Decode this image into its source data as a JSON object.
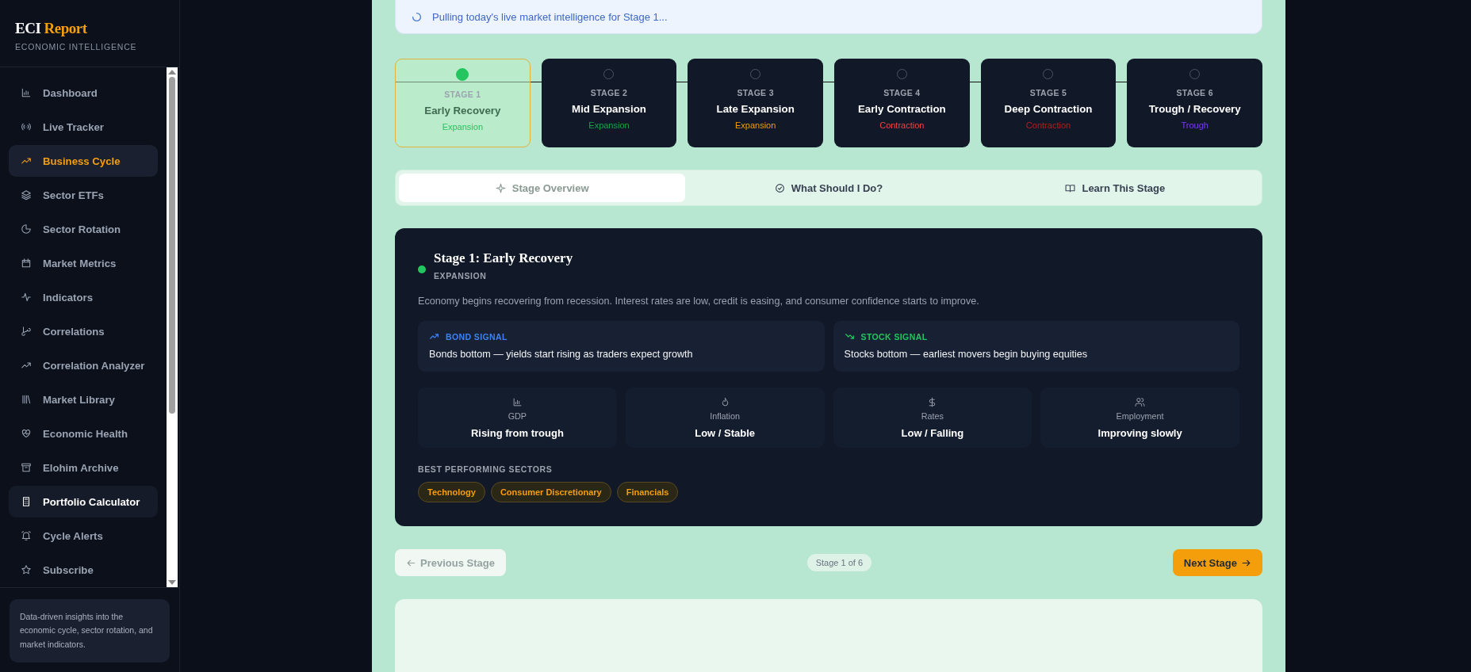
{
  "brand": {
    "name_a": "ECI",
    "name_b": "Report",
    "subtitle": "ECONOMIC INTELLIGENCE"
  },
  "sidebar": {
    "items": [
      {
        "label": "Dashboard",
        "selected": false,
        "hovered": false
      },
      {
        "label": "Live Tracker",
        "selected": false,
        "hovered": false
      },
      {
        "label": "Business Cycle",
        "selected": true,
        "hovered": false
      },
      {
        "label": "Sector ETFs",
        "selected": false,
        "hovered": false
      },
      {
        "label": "Sector Rotation",
        "selected": false,
        "hovered": false
      },
      {
        "label": "Market Metrics",
        "selected": false,
        "hovered": false
      },
      {
        "label": "Indicators",
        "selected": false,
        "hovered": false
      },
      {
        "label": "Correlations",
        "selected": false,
        "hovered": false
      },
      {
        "label": "Correlation Analyzer",
        "selected": false,
        "hovered": false
      },
      {
        "label": "Market Library",
        "selected": false,
        "hovered": false
      },
      {
        "label": "Economic Health",
        "selected": false,
        "hovered": false
      },
      {
        "label": "Elohim Archive",
        "selected": false,
        "hovered": false
      },
      {
        "label": "Portfolio Calculator",
        "selected": false,
        "hovered": true
      },
      {
        "label": "Cycle Alerts",
        "selected": false,
        "hovered": false
      },
      {
        "label": "Subscribe",
        "selected": false,
        "hovered": false
      }
    ],
    "footer": "Data-driven insights into the economic cycle, sector rotation, and market indicators."
  },
  "banner": {
    "text": "Pulling today's live market intelligence for Stage 1..."
  },
  "stages": [
    {
      "number": "STAGE 1",
      "name": "Early Recovery",
      "phase": "Expansion",
      "color": "#22c55e",
      "selected": true
    },
    {
      "number": "STAGE 2",
      "name": "Mid Expansion",
      "phase": "Expansion",
      "color": "#16a34a",
      "selected": false
    },
    {
      "number": "STAGE 3",
      "name": "Late Expansion",
      "phase": "Expansion",
      "color": "#f59e0b",
      "selected": false
    },
    {
      "number": "STAGE 4",
      "name": "Early Contraction",
      "phase": "Contraction",
      "color": "#ef4444",
      "selected": false
    },
    {
      "number": "STAGE 5",
      "name": "Deep Contraction",
      "phase": "Contraction",
      "color": "#b91c1c",
      "selected": false
    },
    {
      "number": "STAGE 6",
      "name": "Trough / Recovery",
      "phase": "Trough",
      "color": "#7c3aed",
      "selected": false
    }
  ],
  "tabs": [
    {
      "label": "Stage Overview",
      "selected": true
    },
    {
      "label": "What Should I Do?",
      "selected": false
    },
    {
      "label": "Learn This Stage",
      "selected": false
    }
  ],
  "detail": {
    "title": "Stage 1: Early Recovery",
    "phase": "EXPANSION",
    "color": "#22c55e",
    "description": "Economy begins recovering from recession. Interest rates are low, credit is easing, and consumer confidence starts to improve.",
    "signals": [
      {
        "kind": "bond",
        "label": "BOND SIGNAL",
        "text": "Bonds bottom — yields start rising as traders expect growth",
        "color": "#3b82f6"
      },
      {
        "kind": "stock",
        "label": "STOCK SIGNAL",
        "text": "Stocks bottom — earliest movers begin buying equities",
        "color": "#22c55e"
      }
    ],
    "metrics": [
      {
        "label": "GDP",
        "value": "Rising from trough"
      },
      {
        "label": "Inflation",
        "value": "Low / Stable"
      },
      {
        "label": "Rates",
        "value": "Low / Falling"
      },
      {
        "label": "Employment",
        "value": "Improving slowly"
      }
    ],
    "sectors_title": "BEST PERFORMING SECTORS",
    "sectors": [
      "Technology",
      "Consumer Discretionary",
      "Financials"
    ]
  },
  "navigation": {
    "previous": {
      "label": "Previous Stage",
      "disabled": true
    },
    "counter": "Stage 1 of 6",
    "next": {
      "label": "Next Stage",
      "disabled": false
    }
  }
}
